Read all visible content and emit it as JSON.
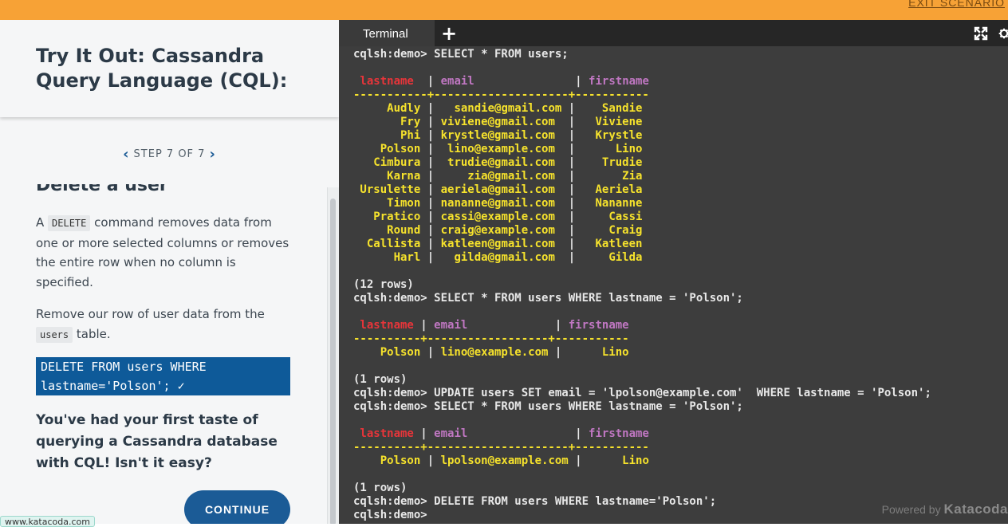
{
  "topbar": {
    "exit_label": "EXIT SCENARIO"
  },
  "scenario": {
    "title": "Try It Out: Cassandra Query Language (CQL):"
  },
  "stepper": {
    "label": "STEP 7 OF 7"
  },
  "step": {
    "heading": "Delete a user",
    "para1_a": "A ",
    "para1_code": "DELETE",
    "para1_b": " command removes data from one or more selected columns or removes the entire row when no column is specified.",
    "para2_a": "Remove our row of user data from the ",
    "para2_code": "users",
    "para2_b": " table.",
    "code": "DELETE FROM users WHERE lastname='Polson'; ✓",
    "final": "You've had your first taste of querying a Cassandra database with CQL! Isn't it easy?",
    "continue_label": "CONTINUE"
  },
  "footer": {
    "link_text": "www.katacoda.com"
  },
  "terminal": {
    "tab_label": "Terminal",
    "powered_label": "Powered by",
    "brand": "Katacoda",
    "lines": [
      [
        {
          "t": "cqlsh:demo> SELECT * FROM users;"
        }
      ],
      [
        {
          "t": ""
        }
      ],
      [
        {
          "t": " lastname ",
          "c": "r"
        },
        {
          "t": " | "
        },
        {
          "t": "email              ",
          "c": "p"
        },
        {
          "t": " | "
        },
        {
          "t": "firstname",
          "c": "p"
        }
      ],
      [
        {
          "t": "-----------+--------------------+-----------",
          "c": "y"
        }
      ],
      [
        {
          "t": "     Audly ",
          "c": "y"
        },
        {
          "t": "|"
        },
        {
          "t": "   sandie@gmail.com ",
          "c": "y"
        },
        {
          "t": "|"
        },
        {
          "t": "    Sandie",
          "c": "y"
        }
      ],
      [
        {
          "t": "       Fry ",
          "c": "y"
        },
        {
          "t": "|"
        },
        {
          "t": " viviene@gmail.com  ",
          "c": "y"
        },
        {
          "t": "|"
        },
        {
          "t": "   Viviene",
          "c": "y"
        }
      ],
      [
        {
          "t": "       Phi ",
          "c": "y"
        },
        {
          "t": "|"
        },
        {
          "t": " krystle@gmail.com  ",
          "c": "y"
        },
        {
          "t": "|"
        },
        {
          "t": "   Krystle",
          "c": "y"
        }
      ],
      [
        {
          "t": "    Polson ",
          "c": "y"
        },
        {
          "t": "|"
        },
        {
          "t": "  lino@example.com  ",
          "c": "y"
        },
        {
          "t": "|"
        },
        {
          "t": "      Lino",
          "c": "y"
        }
      ],
      [
        {
          "t": "   Cimbura ",
          "c": "y"
        },
        {
          "t": "|"
        },
        {
          "t": "  trudie@gmail.com  ",
          "c": "y"
        },
        {
          "t": "|"
        },
        {
          "t": "    Trudie",
          "c": "y"
        }
      ],
      [
        {
          "t": "     Karna ",
          "c": "y"
        },
        {
          "t": "|"
        },
        {
          "t": "     zia@gmail.com  ",
          "c": "y"
        },
        {
          "t": "|"
        },
        {
          "t": "       Zia",
          "c": "y"
        }
      ],
      [
        {
          "t": " Ursulette ",
          "c": "y"
        },
        {
          "t": "|"
        },
        {
          "t": " aeriela@gmail.com  ",
          "c": "y"
        },
        {
          "t": "|"
        },
        {
          "t": "   Aeriela",
          "c": "y"
        }
      ],
      [
        {
          "t": "     Timon ",
          "c": "y"
        },
        {
          "t": "|"
        },
        {
          "t": " nananne@gmail.com  ",
          "c": "y"
        },
        {
          "t": "|"
        },
        {
          "t": "   Nananne",
          "c": "y"
        }
      ],
      [
        {
          "t": "   Pratico ",
          "c": "y"
        },
        {
          "t": "|"
        },
        {
          "t": " cassi@example.com  ",
          "c": "y"
        },
        {
          "t": "|"
        },
        {
          "t": "     Cassi",
          "c": "y"
        }
      ],
      [
        {
          "t": "     Round ",
          "c": "y"
        },
        {
          "t": "|"
        },
        {
          "t": " craig@example.com  ",
          "c": "y"
        },
        {
          "t": "|"
        },
        {
          "t": "     Craig",
          "c": "y"
        }
      ],
      [
        {
          "t": "  Callista ",
          "c": "y"
        },
        {
          "t": "|"
        },
        {
          "t": " katleen@gmail.com  ",
          "c": "y"
        },
        {
          "t": "|"
        },
        {
          "t": "   Katleen",
          "c": "y"
        }
      ],
      [
        {
          "t": "      Harl ",
          "c": "y"
        },
        {
          "t": "|"
        },
        {
          "t": "   gilda@gmail.com  ",
          "c": "y"
        },
        {
          "t": "|"
        },
        {
          "t": "     Gilda",
          "c": "y"
        }
      ],
      [
        {
          "t": ""
        }
      ],
      [
        {
          "t": "(12 rows)"
        }
      ],
      [
        {
          "t": "cqlsh:demo> SELECT * FROM users WHERE lastname = 'Polson';"
        }
      ],
      [
        {
          "t": ""
        }
      ],
      [
        {
          "t": " lastname ",
          "c": "r"
        },
        {
          "t": "| "
        },
        {
          "t": "email            ",
          "c": "p"
        },
        {
          "t": " | "
        },
        {
          "t": "firstname",
          "c": "p"
        }
      ],
      [
        {
          "t": "----------+------------------+-----------",
          "c": "y"
        }
      ],
      [
        {
          "t": "    Polson ",
          "c": "y"
        },
        {
          "t": "| "
        },
        {
          "t": "lino@example.com ",
          "c": "y"
        },
        {
          "t": "|"
        },
        {
          "t": "      Lino",
          "c": "y"
        }
      ],
      [
        {
          "t": ""
        }
      ],
      [
        {
          "t": "(1 rows)"
        }
      ],
      [
        {
          "t": "cqlsh:demo> UPDATE users SET email = 'lpolson@example.com'  WHERE lastname = 'Polson';"
        }
      ],
      [
        {
          "t": "cqlsh:demo> SELECT * FROM users WHERE lastname = 'Polson';"
        }
      ],
      [
        {
          "t": ""
        }
      ],
      [
        {
          "t": " lastname ",
          "c": "r"
        },
        {
          "t": "| "
        },
        {
          "t": "email               ",
          "c": "p"
        },
        {
          "t": " | "
        },
        {
          "t": "firstname",
          "c": "p"
        }
      ],
      [
        {
          "t": "----------+---------------------+-----------",
          "c": "y"
        }
      ],
      [
        {
          "t": "    Polson ",
          "c": "y"
        },
        {
          "t": "| "
        },
        {
          "t": "lpolson@example.com ",
          "c": "y"
        },
        {
          "t": "|"
        },
        {
          "t": "      Lino",
          "c": "y"
        }
      ],
      [
        {
          "t": ""
        }
      ],
      [
        {
          "t": "(1 rows)"
        }
      ],
      [
        {
          "t": "cqlsh:demo> DELETE FROM users WHERE lastname='Polson';"
        }
      ],
      [
        {
          "t": "cqlsh:demo>"
        }
      ]
    ]
  },
  "colors": {
    "accent": "#f7a236",
    "primary": "#1b5b96",
    "code_bg": "#0e5a99",
    "terminal_bg": "#3d3d3d",
    "yellow": "#f6e22c",
    "red": "#e8353a",
    "purple": "#c077c2"
  }
}
